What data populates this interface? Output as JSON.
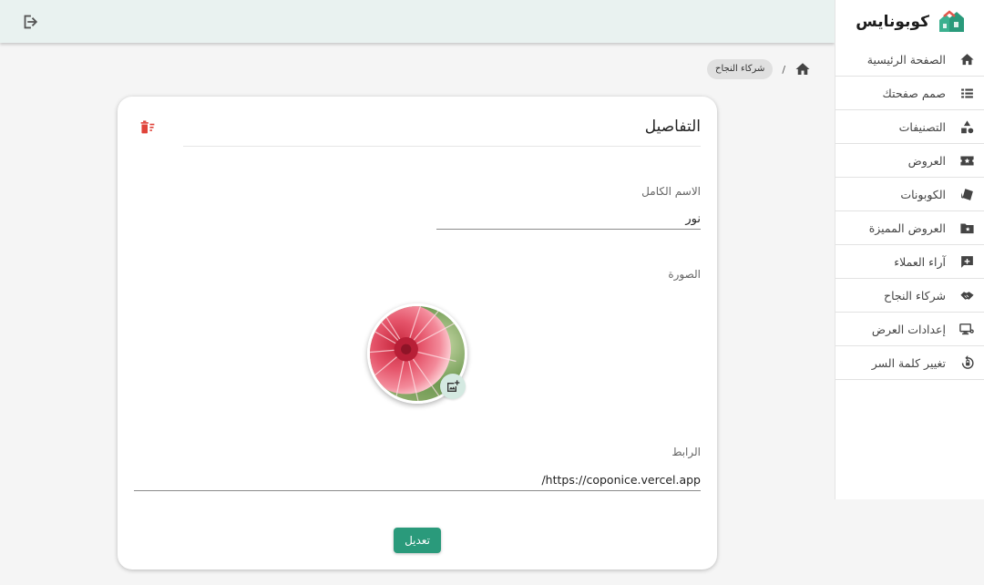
{
  "app": {
    "brand_name": "كوبونايس",
    "accent_color": "#2a9a7b"
  },
  "topbar": {
    "logout_icon": "logout-icon"
  },
  "sidebar": {
    "items": [
      {
        "label": "الصفحة الرئيسية",
        "icon": "home-icon"
      },
      {
        "label": "صمم صفحتك",
        "icon": "list-icon"
      },
      {
        "label": "التصنيفات",
        "icon": "category-icon"
      },
      {
        "label": "العروض",
        "icon": "ticket-star-icon"
      },
      {
        "label": "الكوبونات",
        "icon": "coupon-icon"
      },
      {
        "label": "العروض المميزة",
        "icon": "folder-star-icon"
      },
      {
        "label": "آراء العملاء",
        "icon": "review-icon"
      },
      {
        "label": "شركاء النجاح",
        "icon": "handshake-icon"
      },
      {
        "label": "إعدادات العرض",
        "icon": "display-settings-icon"
      },
      {
        "label": "تغيير كلمة السر",
        "icon": "lock-reset-icon"
      }
    ]
  },
  "breadcrumb": {
    "current": "شركاء النجاح",
    "separator": "/"
  },
  "details": {
    "title": "التفاصيل",
    "full_name_label": "الاسم الكامل",
    "full_name_value": "نور",
    "image_label": "الصورة",
    "link_label": "الرابط",
    "link_value": "https://coponice.vercel.app/",
    "edit_button_label": "تعديل"
  }
}
